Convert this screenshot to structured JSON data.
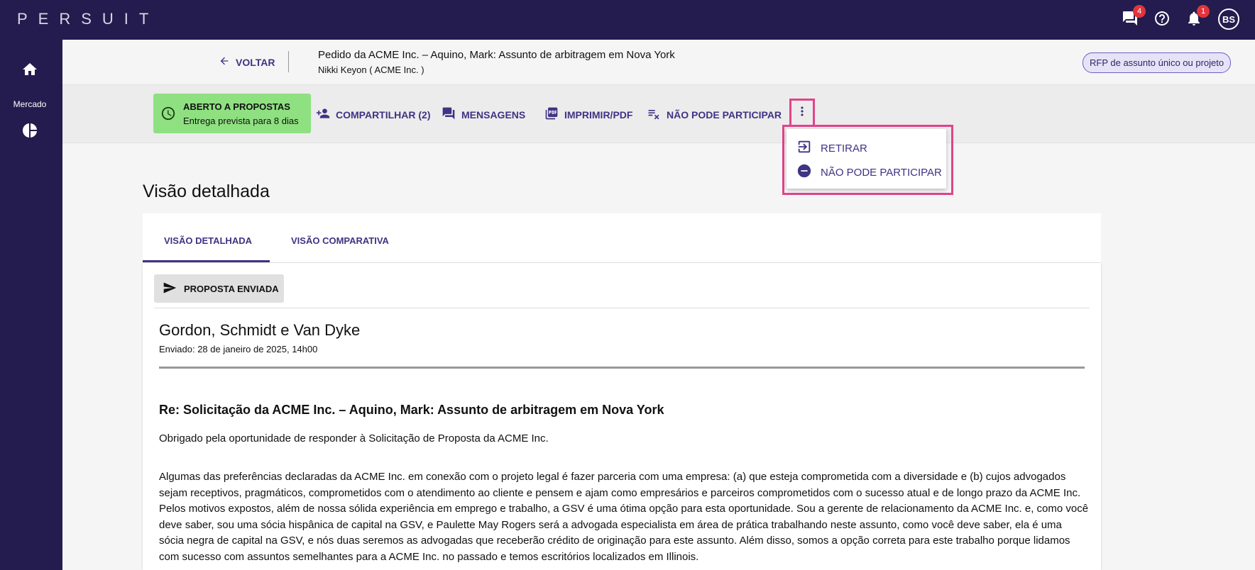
{
  "app": {
    "logo": "PERSUIT"
  },
  "topbar": {
    "messages_badge": "4",
    "notifications_badge": "1",
    "avatar_initials": "BS"
  },
  "sidebar": {
    "items": [
      {
        "icon": "home-icon",
        "label": ""
      },
      {
        "icon": "market-icon",
        "label": "Mercado"
      }
    ]
  },
  "header": {
    "back_label": "VOLTAR",
    "request_title": "Pedido da ACME Inc. – Aquino, Mark: Assunto de arbitragem em Nova York",
    "request_subtitle": "Nikki Keyon ( ACME Inc. )",
    "rfp_type": "RFP de assunto único ou projeto"
  },
  "toolbar": {
    "status_title": "ABERTO A PROPOSTAS",
    "status_subtitle": "Entrega prevista para 8 dias",
    "actions": [
      {
        "icon": "share-icon",
        "label": "COMPARTILHAR (2)"
      },
      {
        "icon": "messages-icon",
        "label": "MENSAGENS"
      },
      {
        "icon": "print-icon",
        "label": "IMPRIMIR/PDF"
      },
      {
        "icon": "decline-icon",
        "label": "NÃO PODE PARTICIPAR"
      }
    ]
  },
  "dropdown": {
    "items": [
      {
        "icon": "withdraw-icon",
        "label": "RETIRAR"
      },
      {
        "icon": "minus-circle-icon",
        "label": "NÃO PODE PARTICIPAR"
      }
    ]
  },
  "main": {
    "title": "Visão detalhada",
    "tabs": [
      {
        "label": "VISÃO DETALHADA",
        "active": true
      },
      {
        "label": "VISÃO COMPARATIVA",
        "active": false
      }
    ],
    "proposal": {
      "status_label": "PROPOSTA ENVIADA",
      "firm_name": "Gordon, Schmidt e Van Dyke",
      "sent_date": "Enviado: 28 de janeiro de 2025, 14h00",
      "re_title": "Re: Solicitação da ACME Inc. – Aquino, Mark: Assunto de arbitragem em Nova York",
      "thanks": "Obrigado pela oportunidade de responder à Solicitação de Proposta da ACME Inc.",
      "paragraph": "Algumas das preferências declaradas da ACME Inc. em conexão com o projeto legal é fazer parceria com uma empresa: (a) que esteja comprometida com a diversidade e (b) cujos advogados sejam receptivos, pragmáticos, comprometidos com o atendimento ao cliente e pensem e ajam como empresários e parceiros comprometidos com o sucesso atual e de longo prazo da ACME Inc. Pelos motivos expostos, além de nossa sólida experiência em emprego e trabalho, a GSV é uma ótima opção para esta oportunidade. Sou a gerente de relacionamento da ACME Inc. e, como você deve saber, sou uma sócia hispânica de capital na GSV, e Paulette May Rogers será a advogada especialista em área de prática trabalhando neste assunto, como você deve saber, ela é uma sócia negra de capital na GSV, e nós duas seremos as advogadas que receberão crédito de originação para este assunto. Além disso, somos a opção correta para este trabalho porque lidamos com sucesso com assuntos semelhantes para a ACME Inc. no passado e temos escritórios localizados em Illinois."
    }
  },
  "colors": {
    "nav_bg": "#241c4e",
    "accent": "#3e3384",
    "status_green": "#8fe081",
    "highlight_pink": "#e0448a",
    "badge_red": "#e0353b"
  }
}
